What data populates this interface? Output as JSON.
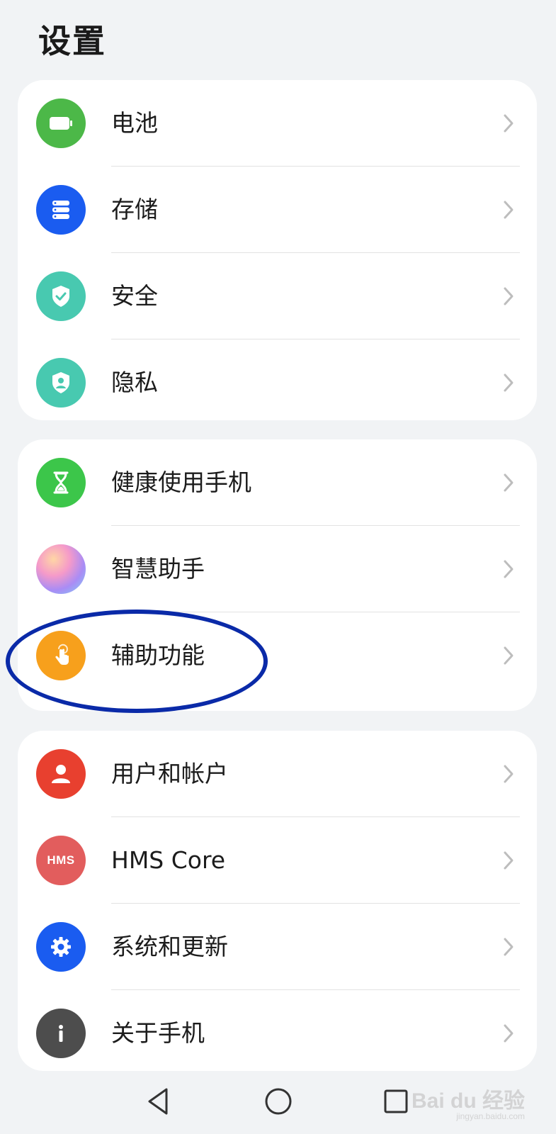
{
  "title": "设置",
  "groups": [
    {
      "items": [
        {
          "label": "电池",
          "icon": "battery-icon",
          "color": "#4cb848"
        },
        {
          "label": "存储",
          "icon": "storage-icon",
          "color": "#1a5cf0"
        },
        {
          "label": "安全",
          "icon": "shield-check-icon",
          "color": "#48c9b0"
        },
        {
          "label": "隐私",
          "icon": "privacy-shield-icon",
          "color": "#48c9b0"
        }
      ]
    },
    {
      "items": [
        {
          "label": "健康使用手机",
          "icon": "hourglass-icon",
          "color": "#3cc64a"
        },
        {
          "label": "智慧助手",
          "icon": "assistant-orb-icon",
          "color": "#c98cf0"
        },
        {
          "label": "辅助功能",
          "icon": "touch-hand-icon",
          "color": "#f7a01c"
        }
      ]
    },
    {
      "items": [
        {
          "label": "用户和帐户",
          "icon": "user-icon",
          "color": "#e8402f"
        },
        {
          "label": "HMS Core",
          "icon": "hms-icon",
          "icon_text": "HMS",
          "color": "#e25d5d"
        },
        {
          "label": "系统和更新",
          "icon": "gear-icon",
          "color": "#1a5cf0"
        },
        {
          "label": "关于手机",
          "icon": "info-icon",
          "color": "#4d4d4d"
        }
      ]
    }
  ],
  "navbar": {
    "back": "back-icon",
    "home": "home-icon",
    "recent": "recent-apps-icon"
  },
  "annotation": {
    "highlighted_item": "辅助功能",
    "color": "#0a2aa8"
  },
  "watermark": {
    "text": "Bai du 经验",
    "sub": "jingyan.baidu.com"
  }
}
